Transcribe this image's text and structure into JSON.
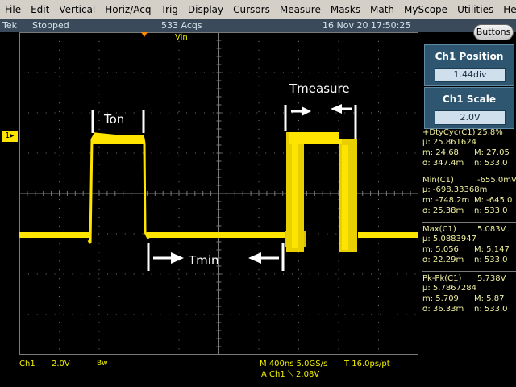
{
  "menu": [
    "File",
    "Edit",
    "Vertical",
    "Horiz/Acq",
    "Trig",
    "Display",
    "Cursors",
    "Measure",
    "Masks",
    "Math",
    "MyScope",
    "Utilities",
    "Help"
  ],
  "status": {
    "brand": "Tek",
    "run_state": "Stopped",
    "acqs": "533 Acqs",
    "datetime": "16 Nov 20 17:50:25",
    "buttons_label": "Buttons"
  },
  "screen": {
    "ch1_marker": "1",
    "vin_label": "Vin",
    "annotations": {
      "ton": "Ton",
      "tmin": "Tmin",
      "tmeasure": "Tmeasure"
    }
  },
  "ch1_position": {
    "title": "Ch1 Position",
    "value": "1.44div"
  },
  "ch1_scale": {
    "title": "Ch1 Scale",
    "value": "2.0V"
  },
  "measurements": [
    {
      "name": "+DtyCyc(C1)",
      "value": "25.8%",
      "mean": "μ: 25.861624",
      "min": "m: 24.68",
      "max": "M: 27.05",
      "sigma": "σ: 347.4m",
      "n": "n: 533.0"
    },
    {
      "name": "Min(C1)",
      "value": "-655.0mV",
      "mean": "μ: -698.33368m",
      "min": "m: -748.2m",
      "max": "M: -645.0",
      "sigma": "σ: 25.38m",
      "n": "n: 533.0"
    },
    {
      "name": "Max(C1)",
      "value": "5.083V",
      "mean": "μ: 5.0883947",
      "min": "m: 5.056",
      "max": "M: 5.147",
      "sigma": "σ: 22.29m",
      "n": "n: 533.0"
    },
    {
      "name": "Pk-Pk(C1)",
      "value": "5.738V",
      "mean": "μ: 5.7867284",
      "min": "m: 5.709",
      "max": "M: 5.87",
      "sigma": "σ: 36.33m",
      "n": "n: 533.0"
    }
  ],
  "bottom": {
    "channel": "Ch1",
    "volts": "2.0V",
    "bw": "Bw",
    "timebase": "M 400ns 5.0GS/s",
    "rate": "IT 16.0ps/pt",
    "trigger": "A  Ch1  ⟍  2.08V"
  },
  "colors": {
    "trace": "#ffe400",
    "graticule": "#7a7a7a",
    "panel": "#2e5670"
  }
}
